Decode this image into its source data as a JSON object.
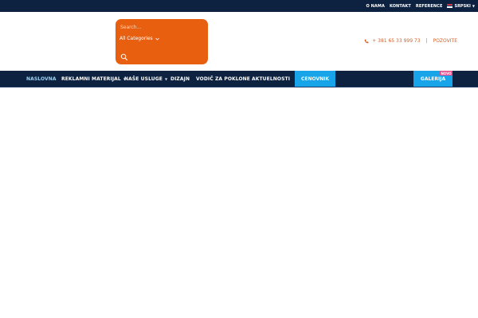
{
  "topbar": {
    "links": [
      "O NAMA",
      "KONTAKT",
      "REFERENCE"
    ],
    "language": "SRPSKI",
    "flag_colors": [
      "#c6363c",
      "#0c4076",
      "#ffffff"
    ]
  },
  "search": {
    "placeholder": "Search...",
    "categories_label": "All Categories",
    "icons": {
      "categories": "chevron-down-icon",
      "submit": "search-icon"
    },
    "box_color": "#e8600f"
  },
  "contact": {
    "phone": "+ 381 65 33 999 73",
    "call_label": "POZOVITE",
    "icon": "phone-icon",
    "color": "#d4622a"
  },
  "nav": {
    "items": [
      {
        "label": "NASLOVNA",
        "active": true
      },
      {
        "label": "REKLAMNI MATERIJAL",
        "dropdown": true
      },
      {
        "label": "NAŠE USLUGE",
        "dropdown": true
      },
      {
        "label": "DIZAJN"
      },
      {
        "label": "VODIČ ZA POKLONE"
      },
      {
        "label": "AKTUELNOSTI"
      }
    ],
    "cenovnik_label": "CENOVNIK",
    "galerija_label": "GALERIJA",
    "galerija_badge": "NOVO",
    "bar_color": "#0d2240",
    "highlight_color": "#17a4e8",
    "badge_color": "#e84c8b"
  }
}
